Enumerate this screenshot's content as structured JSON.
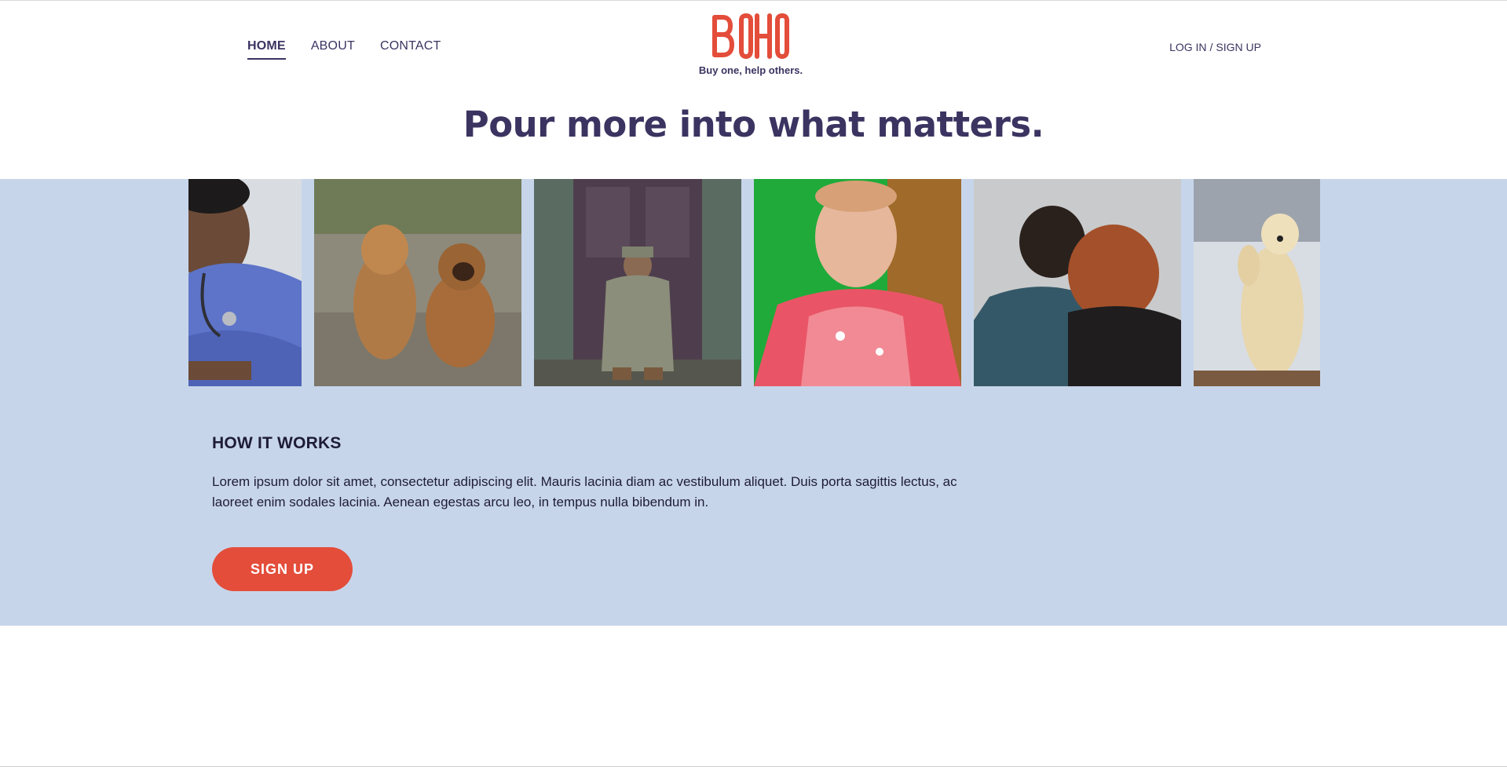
{
  "nav": {
    "items": [
      {
        "label": "HOME",
        "active": true
      },
      {
        "label": "ABOUT",
        "active": false
      },
      {
        "label": "CONTACT",
        "active": false
      }
    ]
  },
  "brand": {
    "logo_text": "BOHO",
    "tagline": "Buy one, help others.",
    "color": "#e34d3a"
  },
  "auth": {
    "login": "LOG IN",
    "separator": "/",
    "signup": "SIGN UP"
  },
  "hero": {
    "headline": "Pour more into what matters."
  },
  "gallery": {
    "photos": [
      {
        "subject": "nurse in scrubs with stethoscope"
      },
      {
        "subject": "two puppies sitting"
      },
      {
        "subject": "soldier sitting on doorstep"
      },
      {
        "subject": "smiling child in pink jacket"
      },
      {
        "subject": "two people embracing"
      },
      {
        "subject": "polar bear standing in snow"
      }
    ]
  },
  "how_it_works": {
    "title": "HOW IT WORKS",
    "text": "Lorem ipsum dolor sit amet, consectetur adipiscing elit. Mauris lacinia diam ac vestibulum aliquet. Duis porta sagittis lectus, ac laoreet enim sodales lacinia. Aenean egestas arcu leo, in tempus nulla bibendum in.",
    "button": "SIGN UP"
  },
  "colors": {
    "primary_text": "#3b3461",
    "accent": "#e34d3a",
    "band_background": "#c7d5ea"
  }
}
